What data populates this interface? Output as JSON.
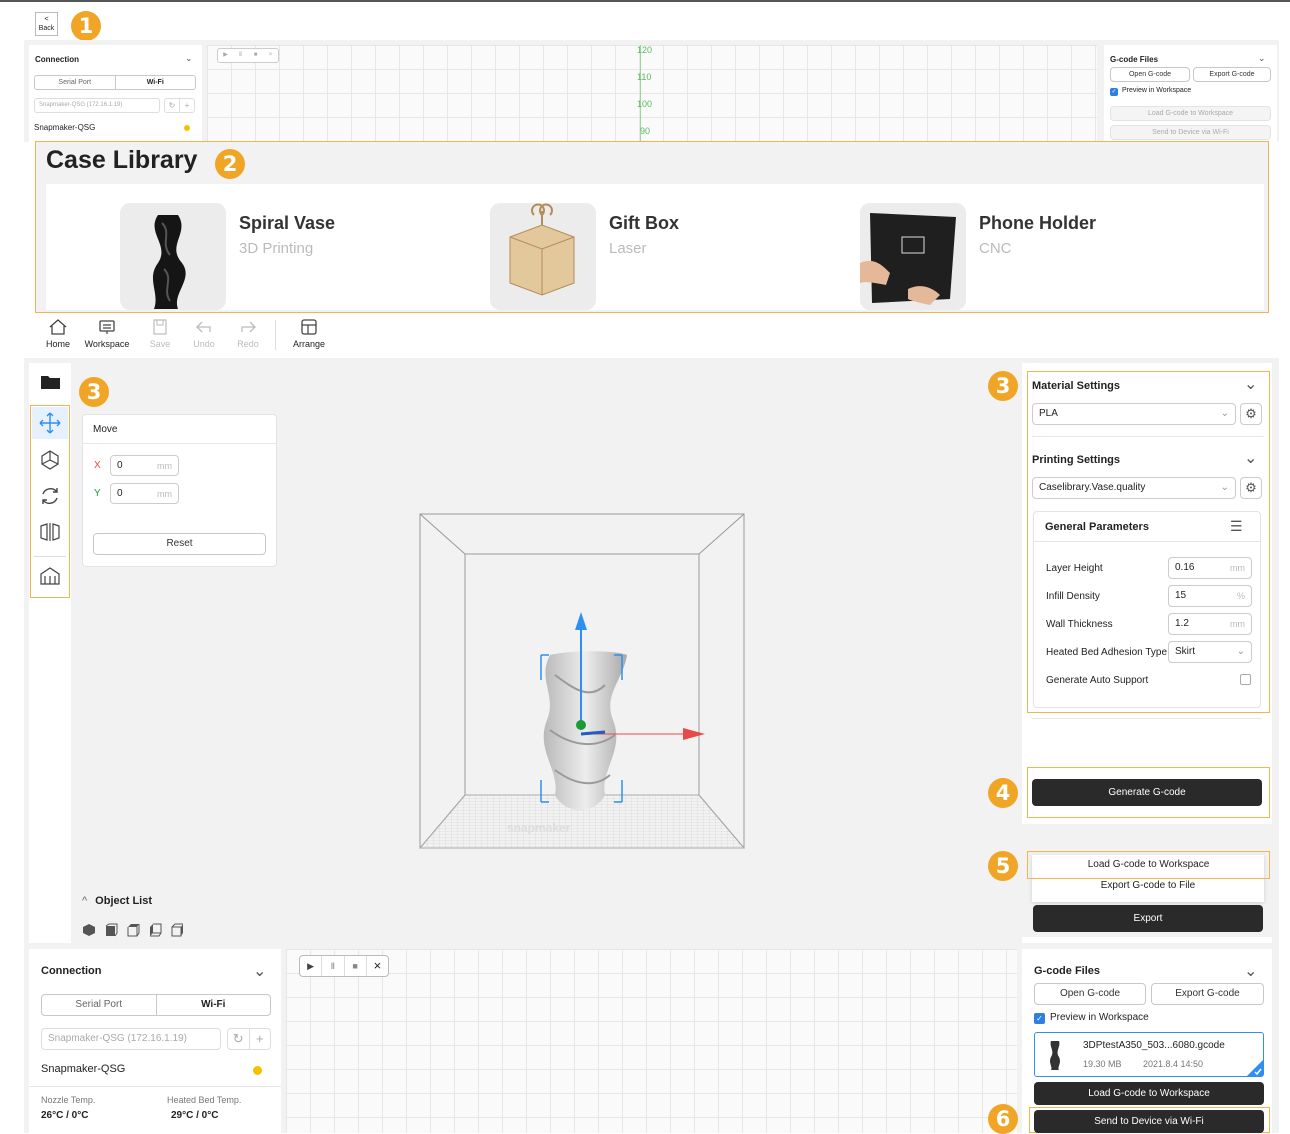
{
  "back_label": "Back",
  "badges": [
    "1",
    "2",
    "3",
    "3",
    "4",
    "5",
    "6"
  ],
  "top": {
    "connection": {
      "title": "Connection",
      "tabs": [
        "Serial Port",
        "Wi-Fi"
      ],
      "device_select": "Snapmaker-QSG (172.16.1.19)",
      "device_name": "Snapmaker-QSG"
    },
    "ruler": [
      "120",
      "110",
      "100",
      "90"
    ],
    "gcode": {
      "title": "G-code Files",
      "open": "Open G-code",
      "export": "Export G-code",
      "preview": "Preview in Workspace",
      "load": "Load G-code to Workspace",
      "send": "Send to Device via Wi-Fi"
    }
  },
  "case_library": {
    "title": "Case Library",
    "cases": [
      {
        "name": "Spiral Vase",
        "type": "3D Printing"
      },
      {
        "name": "Gift Box",
        "type": "Laser"
      },
      {
        "name": "Phone Holder",
        "type": "CNC"
      }
    ]
  },
  "toolbar": {
    "home": "Home",
    "workspace": "Workspace",
    "save": "Save",
    "undo": "Undo",
    "redo": "Redo",
    "arrange": "Arrange"
  },
  "move_panel": {
    "title": "Move",
    "x_label": "X",
    "x_value": "0",
    "y_label": "Y",
    "y_value": "0",
    "unit": "mm",
    "reset": "Reset"
  },
  "object_list": {
    "title": "Object List"
  },
  "settings": {
    "material_title": "Material Settings",
    "material_value": "PLA",
    "printing_title": "Printing Settings",
    "printing_value": "Caselibrary.Vase.quality",
    "general_title": "General Parameters",
    "params": [
      {
        "label": "Layer Height",
        "value": "0.16",
        "unit": "mm"
      },
      {
        "label": "Infill Density",
        "value": "15",
        "unit": "%"
      },
      {
        "label": "Wall Thickness",
        "value": "1.2",
        "unit": "mm"
      },
      {
        "label": "Heated Bed Adhesion Type",
        "value": "Skirt",
        "unit": ""
      },
      {
        "label": "Generate Auto Support",
        "value": "",
        "unit": ""
      }
    ]
  },
  "generate_label": "Generate G-code",
  "export_menu": {
    "load": "Load G-code to Workspace",
    "export_file": "Export G-code to File",
    "export": "Export"
  },
  "bottom": {
    "connection": {
      "title": "Connection",
      "tabs": [
        "Serial Port",
        "Wi-Fi"
      ],
      "device_select": "Snapmaker-QSG (172.16.1.19)",
      "device_name": "Snapmaker-QSG",
      "nozzle_label": "Nozzle Temp.",
      "nozzle_value": "26°C / 0°C",
      "bed_label": "Heated Bed Temp.",
      "bed_value": "29°C / 0°C"
    },
    "gcode": {
      "title": "G-code Files",
      "open": "Open G-code",
      "export": "Export G-code",
      "preview": "Preview in Workspace",
      "file_name": "3DPtestA350_503...6080.gcode",
      "file_size": "19.30 MB",
      "file_date": "2021.8.4 14:50",
      "load": "Load G-code to Workspace",
      "send": "Send to Device via Wi-Fi"
    }
  },
  "colors": {
    "accent": "#f0a526",
    "highlight_border": "#f0b450",
    "dark": "#2a2a2a",
    "axis_x": "#e84a4a",
    "axis_y": "#2f8ff0",
    "axis_z": "#1a9a3a"
  }
}
